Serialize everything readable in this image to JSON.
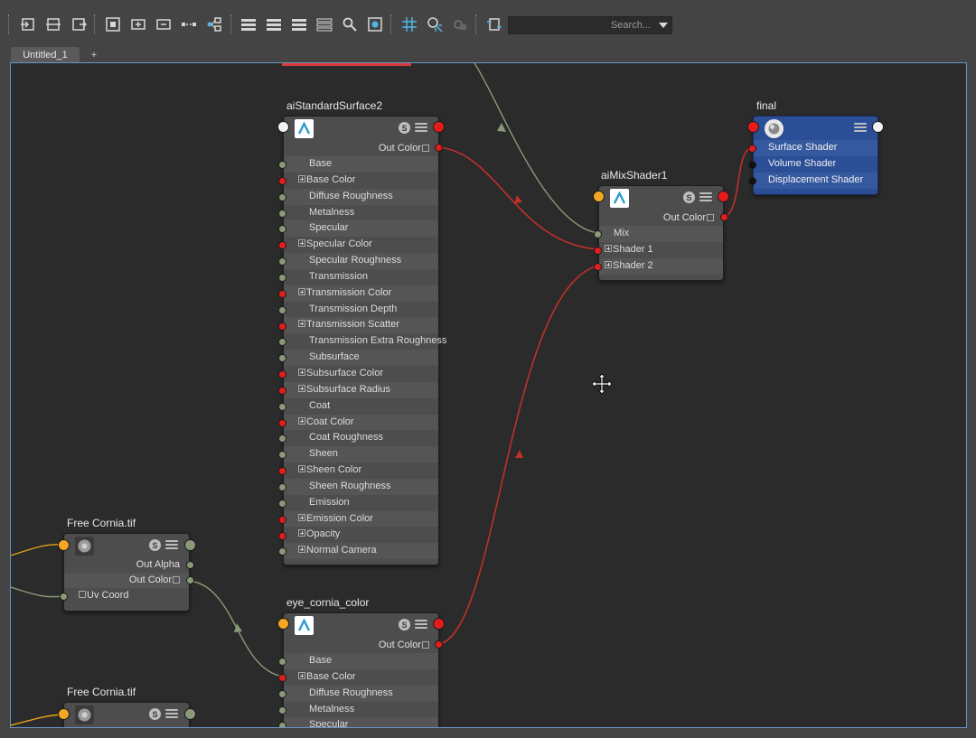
{
  "toolbar": {
    "search_placeholder": "Search..."
  },
  "tabs": {
    "active": "Untitled_1",
    "add": "+"
  },
  "colors": {
    "accent_selection": "#6b93c6",
    "wire_color": "#c0302a",
    "wire_float": "#8a9a78",
    "wire_alpha": "#e5a21c",
    "shading_group": "#2b4e96"
  },
  "icons": [
    "toolbar-icons",
    "search-icon",
    "grid-icon",
    "arnold-icon",
    "texture-icon",
    "move-cursor-icon"
  ],
  "nodes": {
    "ai_standard_surface2": {
      "title": "aiStandardSurface2",
      "out": "Out Color",
      "attrs": [
        "Base",
        "Base Color",
        "Diffuse Roughness",
        "Metalness",
        "Specular",
        "Specular Color",
        "Specular Roughness",
        "Transmission",
        "Transmission Color",
        "Transmission Depth",
        "Transmission Scatter",
        "Transmission Extra Roughness",
        "Subsurface",
        "Subsurface Color",
        "Subsurface Radius",
        "Coat",
        "Coat Color",
        "Coat Roughness",
        "Sheen",
        "Sheen Color",
        "Sheen Roughness",
        "Emission",
        "Emission Color",
        "Opacity",
        "Normal Camera"
      ]
    },
    "ai_mix_shader1": {
      "title": "aiMixShader1",
      "out": "Out Color",
      "attrs": [
        "Mix",
        "Shader 1",
        "Shader 2"
      ]
    },
    "final": {
      "title": "final",
      "attrs": [
        "Surface Shader",
        "Volume Shader",
        "Displacement Shader"
      ]
    },
    "free_cornia_1": {
      "title": "Free Cornia.tif",
      "out_alpha": "Out Alpha",
      "out_color": "Out Color",
      "uv": "Uv Coord"
    },
    "eye_cornia_color": {
      "title": "eye_cornia_color",
      "out": "Out Color",
      "attrs": [
        "Base",
        "Base Color",
        "Diffuse Roughness",
        "Metalness",
        "Specular"
      ]
    },
    "free_cornia_2": {
      "title": "Free Cornia.tif"
    }
  },
  "head_button_s": "S"
}
